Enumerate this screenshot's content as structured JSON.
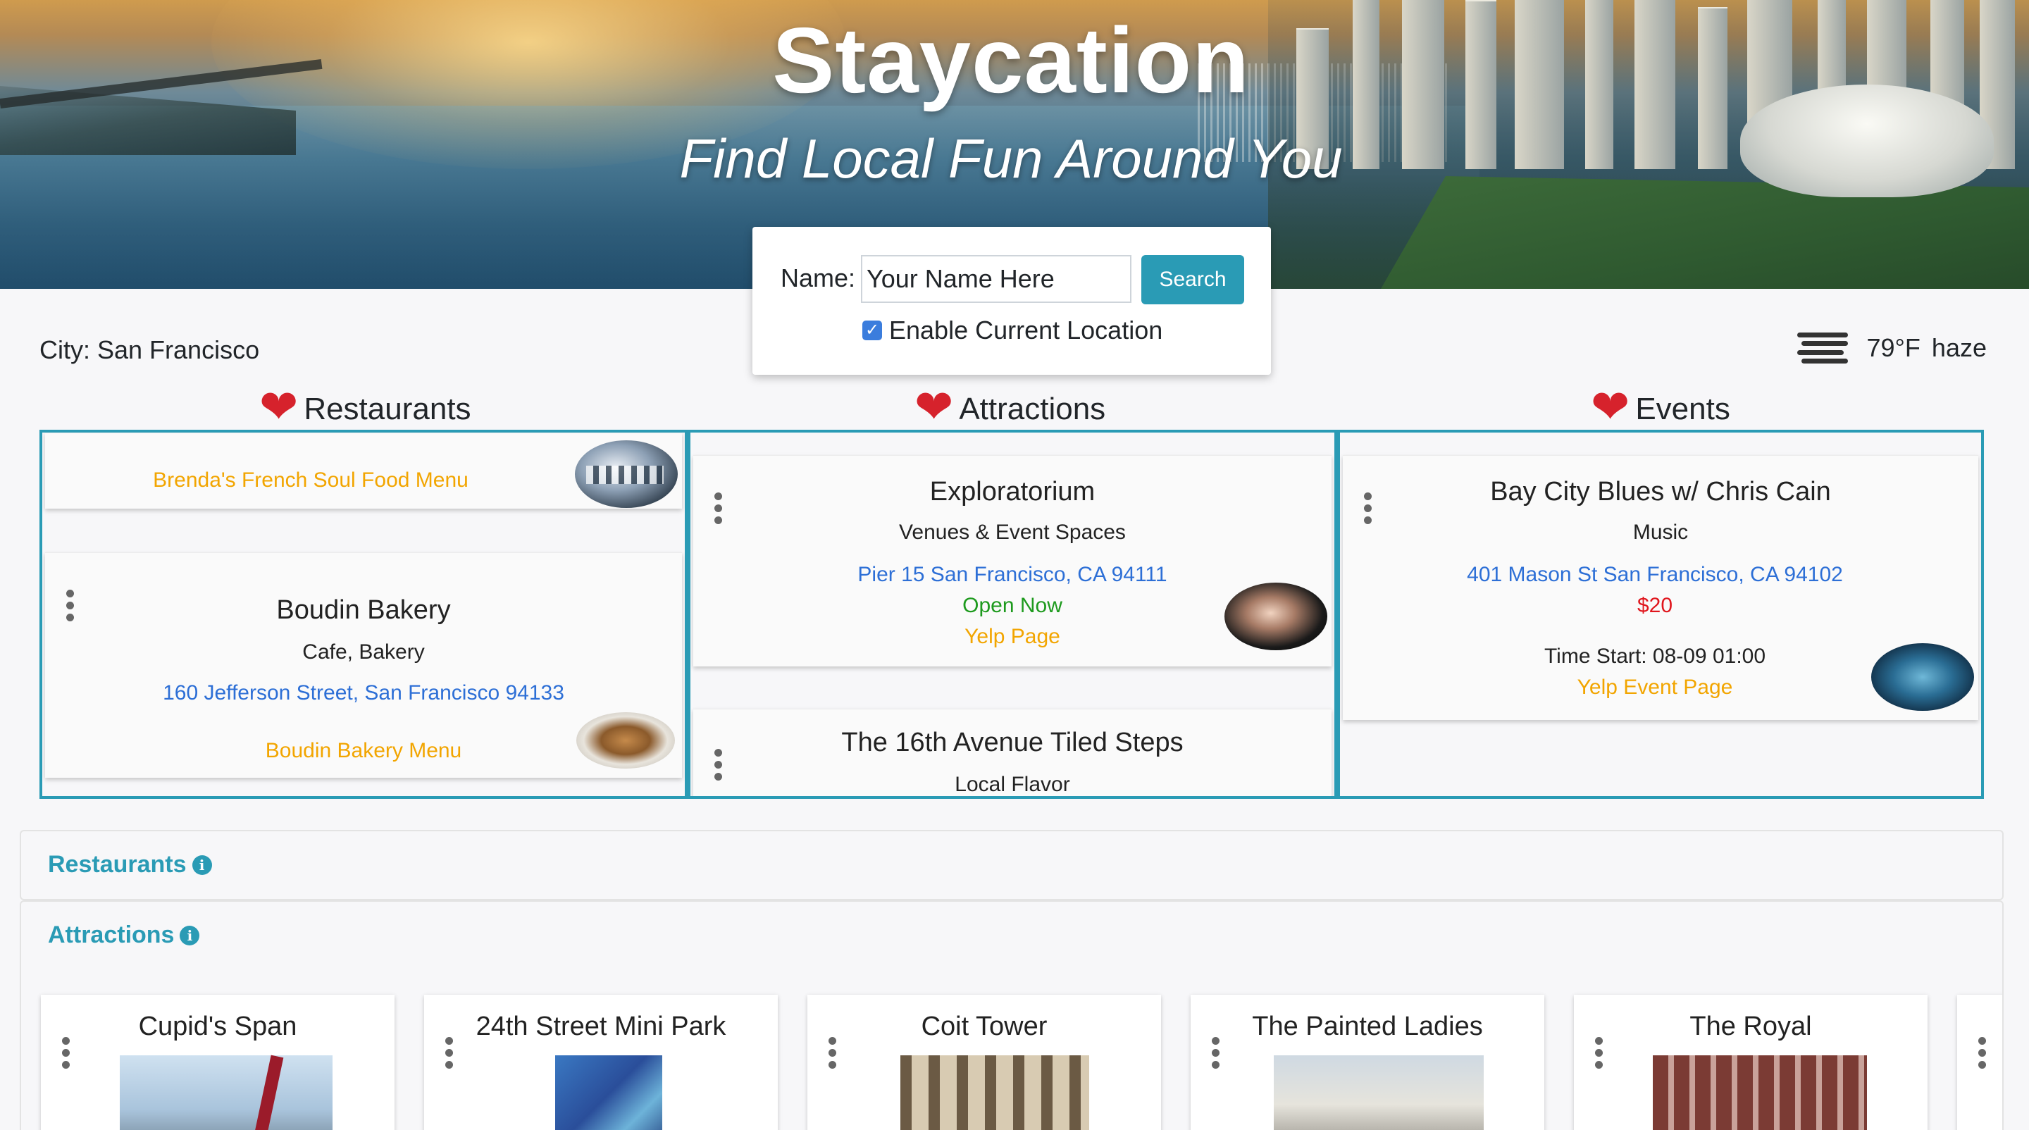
{
  "hero": {
    "title": "Staycation",
    "subtitle": "Find Local Fun Around You"
  },
  "name_form": {
    "label": "Name:",
    "input_value": "Your Name Here",
    "search_label": "Search",
    "location_checkbox_label": "Enable Current Location",
    "location_checked": true
  },
  "city": "City: San Francisco",
  "weather": {
    "icon": "haze-icon",
    "temperature": "79°F",
    "condition": "haze"
  },
  "colors": {
    "accent": "#2a9bb5",
    "heart": "#d6222c",
    "link_blue": "#2d6fd6",
    "link_orange": "#f2a500",
    "open_green": "#1d9a1d",
    "price_red": "#e0161d"
  },
  "sections": {
    "restaurants": {
      "title": "Restaurants",
      "cards": [
        {
          "menu": "Brenda's French Soul Food Menu"
        },
        {
          "name": "Boudin Bakery",
          "type": "Cafe, Bakery",
          "address": "160 Jefferson Street, San Francisco 94133",
          "menu": "Boudin Bakery Menu"
        }
      ]
    },
    "attractions": {
      "title": "Attractions",
      "cards": [
        {
          "name": "Exploratorium",
          "type": "Venues & Event Spaces",
          "address": "Pier 15 San Francisco, CA 94111",
          "status": "Open Now",
          "link": "Yelp Page"
        },
        {
          "name": "The 16th Avenue Tiled Steps",
          "type": "Local Flavor"
        }
      ]
    },
    "events": {
      "title": "Events",
      "cards": [
        {
          "name": "Bay City Blues w/ Chris Cain",
          "type": "Music",
          "address": "401 Mason St San Francisco, CA 94102",
          "price": "$20",
          "time": "Time Start: 08-09 01:00",
          "link": "Yelp Event Page"
        }
      ]
    }
  },
  "accordions": [
    {
      "title": "Restaurants",
      "icon": "info-icon"
    },
    {
      "title": "Attractions",
      "icon": "info-icon"
    }
  ],
  "carousel": [
    {
      "title": "Cupid's Span"
    },
    {
      "title": "24th Street Mini Park"
    },
    {
      "title": "Coit Tower"
    },
    {
      "title": "The Painted Ladies"
    },
    {
      "title": "The Royal"
    }
  ]
}
